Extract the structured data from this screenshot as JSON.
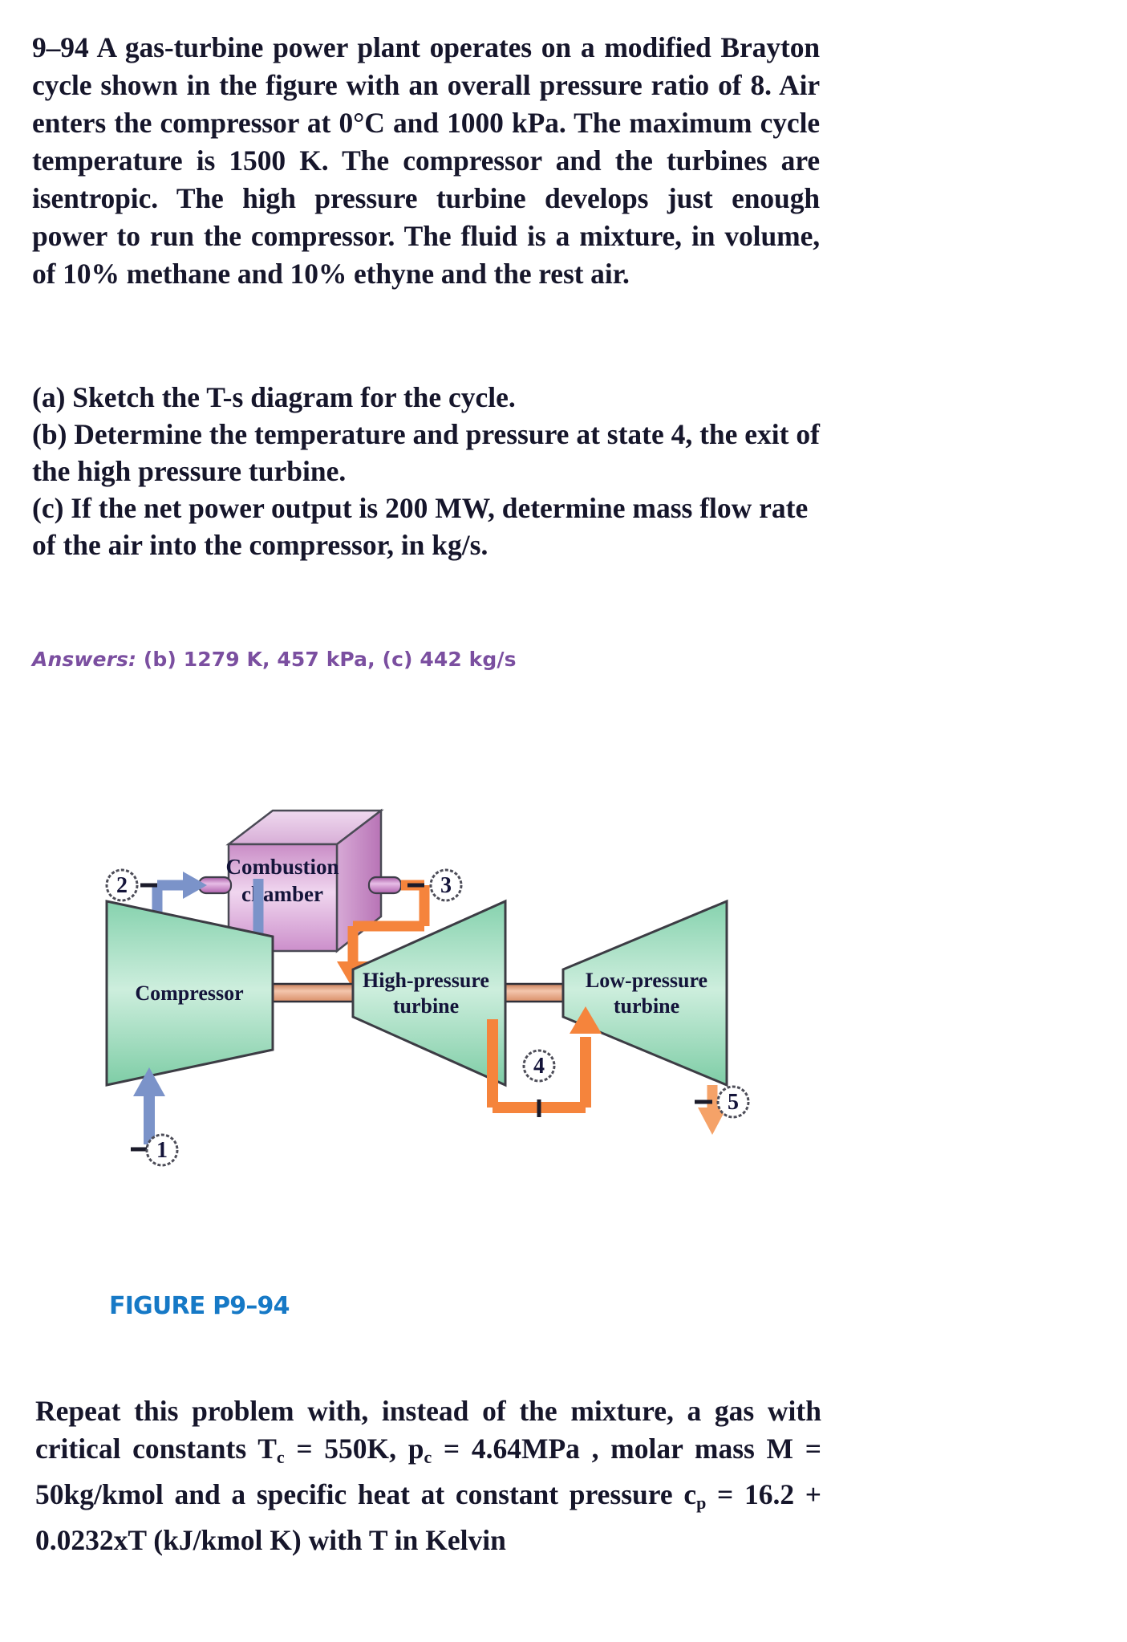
{
  "problem": {
    "number": "9–94",
    "statement": "A gas-turbine power plant operates on a modified Brayton cycle shown in the figure with an overall pressure ratio of 8. Air enters the compressor at 0°C and 1000 kPa. The maximum cycle temperature is 1500 K. The compressor and the turbines are isentropic. The high pressure turbine develops just enough power to run the compressor. The fluid is a mixture, in volume, of 10% methane and 10% ethyne and the rest air.",
    "parts": [
      "(a) Sketch the T-s diagram for the cycle.",
      "(b) Determine the temperature and pressure at state 4, the exit of the high pressure turbine.",
      "(c) If the net power output is 200 MW, determine mass flow rate of the air into the compressor, in kg/s."
    ],
    "answers_label": "Answers:",
    "answers_text": "(b) 1279 K, 457 kPa, (c) 442 kg/s",
    "answers_color": "#7b4fa0"
  },
  "figure": {
    "caption": "FIGURE P9–94",
    "caption_color": "#1679c6",
    "devices": [
      {
        "id": "combustion-chamber",
        "label_line1": "Combustion",
        "label_line2": "chamber"
      },
      {
        "id": "compressor",
        "label_line1": "Compressor",
        "label_line2": ""
      },
      {
        "id": "high-pressure-turbine",
        "label_line1": "High-pressure",
        "label_line2": "turbine"
      },
      {
        "id": "low-pressure-turbine",
        "label_line1": "Low-pressure",
        "label_line2": "turbine"
      }
    ],
    "states": [
      "1",
      "2",
      "3",
      "4",
      "5"
    ],
    "colors": {
      "device_fill": "#8fd7b5",
      "chamber_fill": "#d9a3d4",
      "cold_stream": "#7b93c9",
      "hot_stream": "#f5843c",
      "shaft": "#e8a583"
    }
  },
  "bottom": {
    "text": "Repeat this problem with, instead of the mixture, a gas with critical constants T_c = 550K, p_c = 4.64MPa , molar mass M = 50kg/kmol and a specific heat at constant pressure c_p = 16.2 + 0.0232xT (kJ/kmol K) with T in Kelvin"
  }
}
